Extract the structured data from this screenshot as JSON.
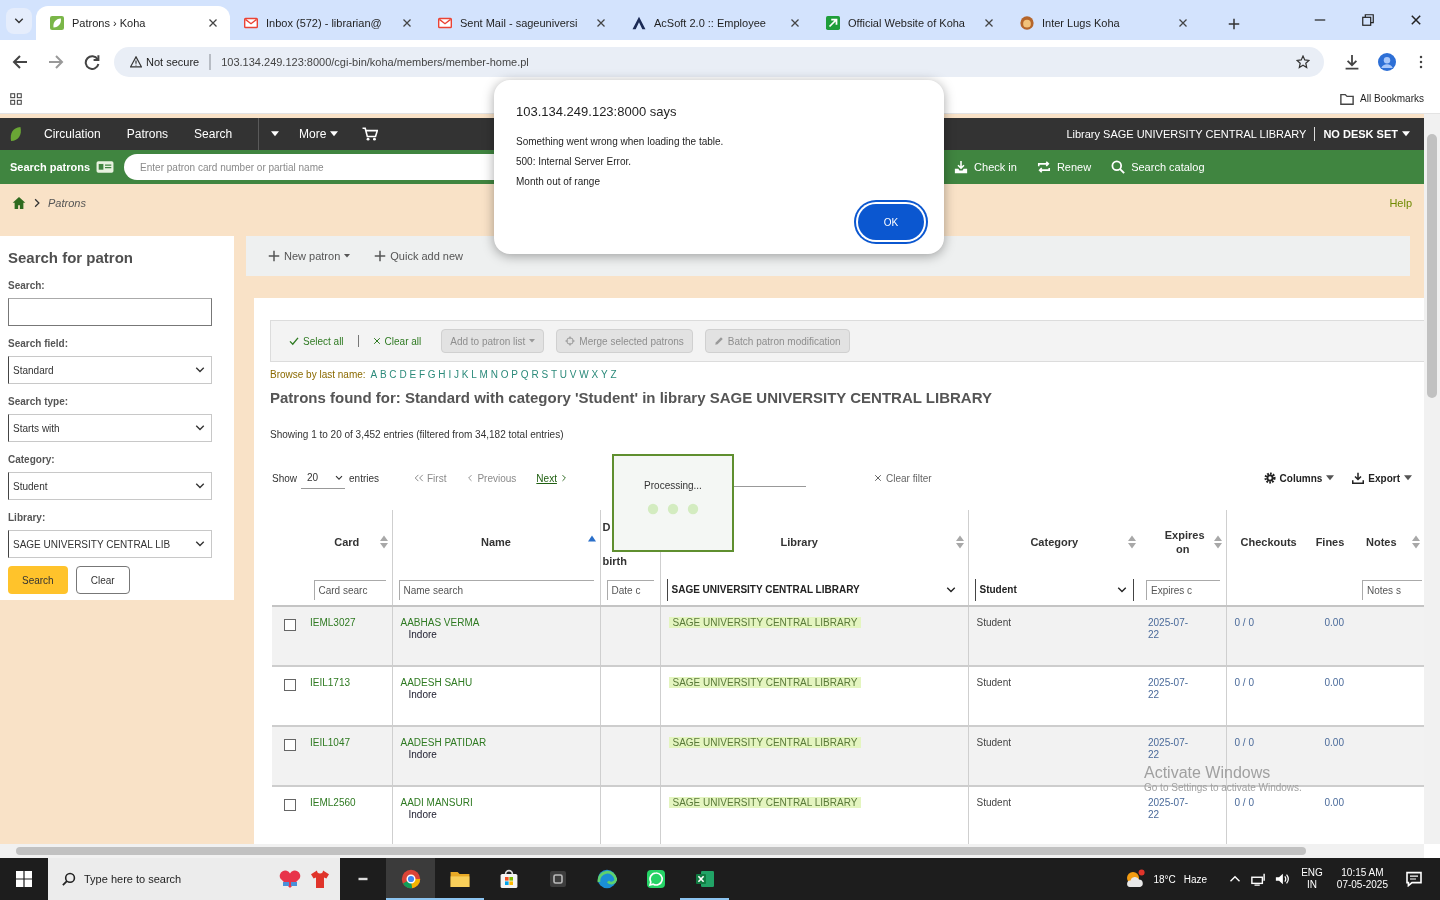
{
  "browser": {
    "tabs": [
      {
        "title": "Patrons › Koha",
        "kind": "koha",
        "selected": true
      },
      {
        "title": "Inbox (572) - librarian@",
        "kind": "mail",
        "selected": false
      },
      {
        "title": "Sent Mail - sageuniversi",
        "kind": "mail",
        "selected": false
      },
      {
        "title": "AcSoft 2.0 :: Employee",
        "kind": "acsoft",
        "selected": false
      },
      {
        "title": "Official Website of Koha",
        "kind": "website",
        "selected": false
      },
      {
        "title": "Inter Lugs Koha",
        "kind": "bugs",
        "selected": false
      }
    ],
    "address_bar": {
      "security": "Not secure",
      "url": "103.134.249.123:8000/cgi-bin/koha/members/member-home.pl"
    },
    "bookmarks_bar": {
      "folder": "All Bookmarks"
    }
  },
  "dialog": {
    "title": "103.134.249.123:8000 says",
    "lines": [
      "Something went wrong when loading the table.",
      "500: Internal Server Error.",
      "Month out of range"
    ],
    "button": "OK"
  },
  "koha_nav": {
    "items": [
      "Circulation",
      "Patrons",
      "Search"
    ],
    "more": "More",
    "library": "Library SAGE UNIVERSITY CENTRAL LIBRARY",
    "desk": "NO DESK SET"
  },
  "patron_search_bar": {
    "label": "Search patrons",
    "placeholder": "Enter patron card number or partial name",
    "shortcuts": [
      {
        "label": "Check in",
        "kind": "checkin"
      },
      {
        "label": "Renew",
        "kind": "renew"
      },
      {
        "label": "Search catalog",
        "kind": "catalog"
      }
    ]
  },
  "breadcrumb": {
    "items": [
      "Patrons"
    ],
    "help": "Help"
  },
  "sidebar": {
    "title": "Search for patron",
    "fields": [
      {
        "label": "Search:",
        "kind": "text"
      },
      {
        "label": "Search field:",
        "kind": "select",
        "value": "Standard"
      },
      {
        "label": "Search type:",
        "kind": "select",
        "value": "Starts with"
      },
      {
        "label": "Category:",
        "kind": "select",
        "value": "Student"
      },
      {
        "label": "Library:",
        "kind": "select",
        "value": "SAGE UNIVERSITY CENTRAL LIB"
      }
    ],
    "buttons": [
      {
        "label": "Search",
        "kind": "primary"
      },
      {
        "label": "Clear",
        "kind": "secondary"
      }
    ]
  },
  "toolbar": {
    "buttons": [
      {
        "label": "New patron",
        "kind": "dropdown"
      },
      {
        "label": "Quick add new",
        "kind": "plain"
      }
    ]
  },
  "results": {
    "actions": [
      {
        "label": "Select all",
        "kind": "check",
        "disabled": false
      },
      {
        "label": "Clear all",
        "kind": "clear",
        "disabled": false
      },
      {
        "label": "Add to patron list",
        "kind": "dropdown",
        "disabled": true
      },
      {
        "label": "Merge selected patrons",
        "kind": "merge",
        "disabled": true
      },
      {
        "label": "Batch patron modification",
        "kind": "edit",
        "disabled": true
      }
    ],
    "browse": {
      "label": "Browse by last name:",
      "letters": [
        "A",
        "B",
        "C",
        "D",
        "E",
        "F",
        "G",
        "H",
        "I",
        "J",
        "K",
        "L",
        "M",
        "N",
        "O",
        "P",
        "Q",
        "R",
        "S",
        "T",
        "U",
        "V",
        "W",
        "X",
        "Y",
        "Z"
      ]
    },
    "heading": "Patrons found for: Standard with category 'Student' in library SAGE UNIVERSITY CENTRAL LIBRARY",
    "info": "Showing 1 to 20 of 3,452 entries (filtered from 34,182 total entries)",
    "length_menu": {
      "before": "Show",
      "value": "20",
      "after": "entries"
    },
    "pager": [
      {
        "label": "First",
        "kind": "first",
        "disabled": true
      },
      {
        "label": "Previous",
        "kind": "previous",
        "disabled": true
      },
      {
        "label": "Next",
        "kind": "next",
        "disabled": false
      }
    ],
    "processing": "Processing...",
    "clear_filter": "Clear filter",
    "columns_button": "Columns",
    "export_button": "Export",
    "table": {
      "columns": [
        {
          "kind": "checkbox"
        },
        {
          "kind": "data",
          "label": "Card",
          "sortable": true,
          "sorted": false,
          "filter": {
            "kind": "text",
            "placeholder": "Card searc"
          }
        },
        {
          "kind": "data",
          "label": "Name",
          "sortable": true,
          "sorted": true,
          "filter": {
            "kind": "text",
            "placeholder": "Name search"
          }
        },
        {
          "kind": "data",
          "label_lines": [
            "D",
            "birth"
          ],
          "sortable": false,
          "filter": {
            "kind": "text",
            "placeholder": "Date c"
          }
        },
        {
          "kind": "data",
          "label": "Library",
          "sortable": true,
          "sorted": false,
          "filter": {
            "kind": "select",
            "value": "SAGE UNIVERSITY CENTRAL LIBRARY"
          }
        },
        {
          "kind": "data",
          "label": "Category",
          "sortable": true,
          "sorted": false,
          "filter": {
            "kind": "select",
            "value": "Student"
          }
        },
        {
          "kind": "data",
          "label": "Expires on",
          "sortable": true,
          "sorted": false,
          "filter": {
            "kind": "text",
            "placeholder": "Expires c"
          }
        },
        {
          "kind": "data",
          "label": "Checkouts",
          "sortable": false
        },
        {
          "kind": "data",
          "label": "Fines",
          "sortable": false
        },
        {
          "kind": "data",
          "label": "Notes",
          "sortable": true,
          "sorted": false,
          "filter": {
            "kind": "text",
            "placeholder": "Notes s"
          }
        }
      ],
      "rows": [
        {
          "checked": false,
          "card": "IEML3027",
          "name": "AABHAS VERMA",
          "city": "Indore",
          "library": "SAGE UNIVERSITY CENTRAL LIBRARY",
          "category": "Student",
          "expires": "2025-07-22",
          "checkouts": "0 / 0",
          "fines": "0.00"
        },
        {
          "checked": false,
          "card": "IEIL1713",
          "name": "AADESH SAHU",
          "city": "Indore",
          "library": "SAGE UNIVERSITY CENTRAL LIBRARY",
          "category": "Student",
          "expires": "2025-07-22",
          "checkouts": "0 / 0",
          "fines": "0.00"
        },
        {
          "checked": false,
          "card": "IEIL1047",
          "name": "AADESH PATIDAR",
          "city": "Indore",
          "library": "SAGE UNIVERSITY CENTRAL LIBRARY",
          "category": "Student",
          "expires": "2025-07-22",
          "checkouts": "0 / 0",
          "fines": "0.00"
        },
        {
          "checked": false,
          "card": "IEML2560",
          "name": "AADI MANSURI",
          "city": "Indore",
          "library": "SAGE UNIVERSITY CENTRAL LIBRARY",
          "category": "Student",
          "expires": "2025-07-22",
          "checkouts": "0 / 0",
          "fines": "0.00"
        }
      ]
    }
  },
  "os_notice": {
    "title": "Activate Windows",
    "text": "Go to Settings to activate Windows."
  },
  "taskbar": {
    "search_placeholder": "Type here to search",
    "apps": [
      {
        "kind": "browser",
        "running": true,
        "active": true
      },
      {
        "kind": "folder",
        "running": true,
        "active": false
      },
      {
        "kind": "store",
        "running": false,
        "active": false
      },
      {
        "kind": "app",
        "running": false,
        "active": false
      },
      {
        "kind": "edge",
        "running": false,
        "active": false
      },
      {
        "kind": "chat",
        "running": false,
        "active": false
      },
      {
        "kind": "sheet",
        "running": true,
        "active": false
      }
    ],
    "temperature": "18°C",
    "weather": "Haze",
    "language": "ENG",
    "region": "IN",
    "time": "10:15 AM",
    "date": "07-05-2025"
  }
}
